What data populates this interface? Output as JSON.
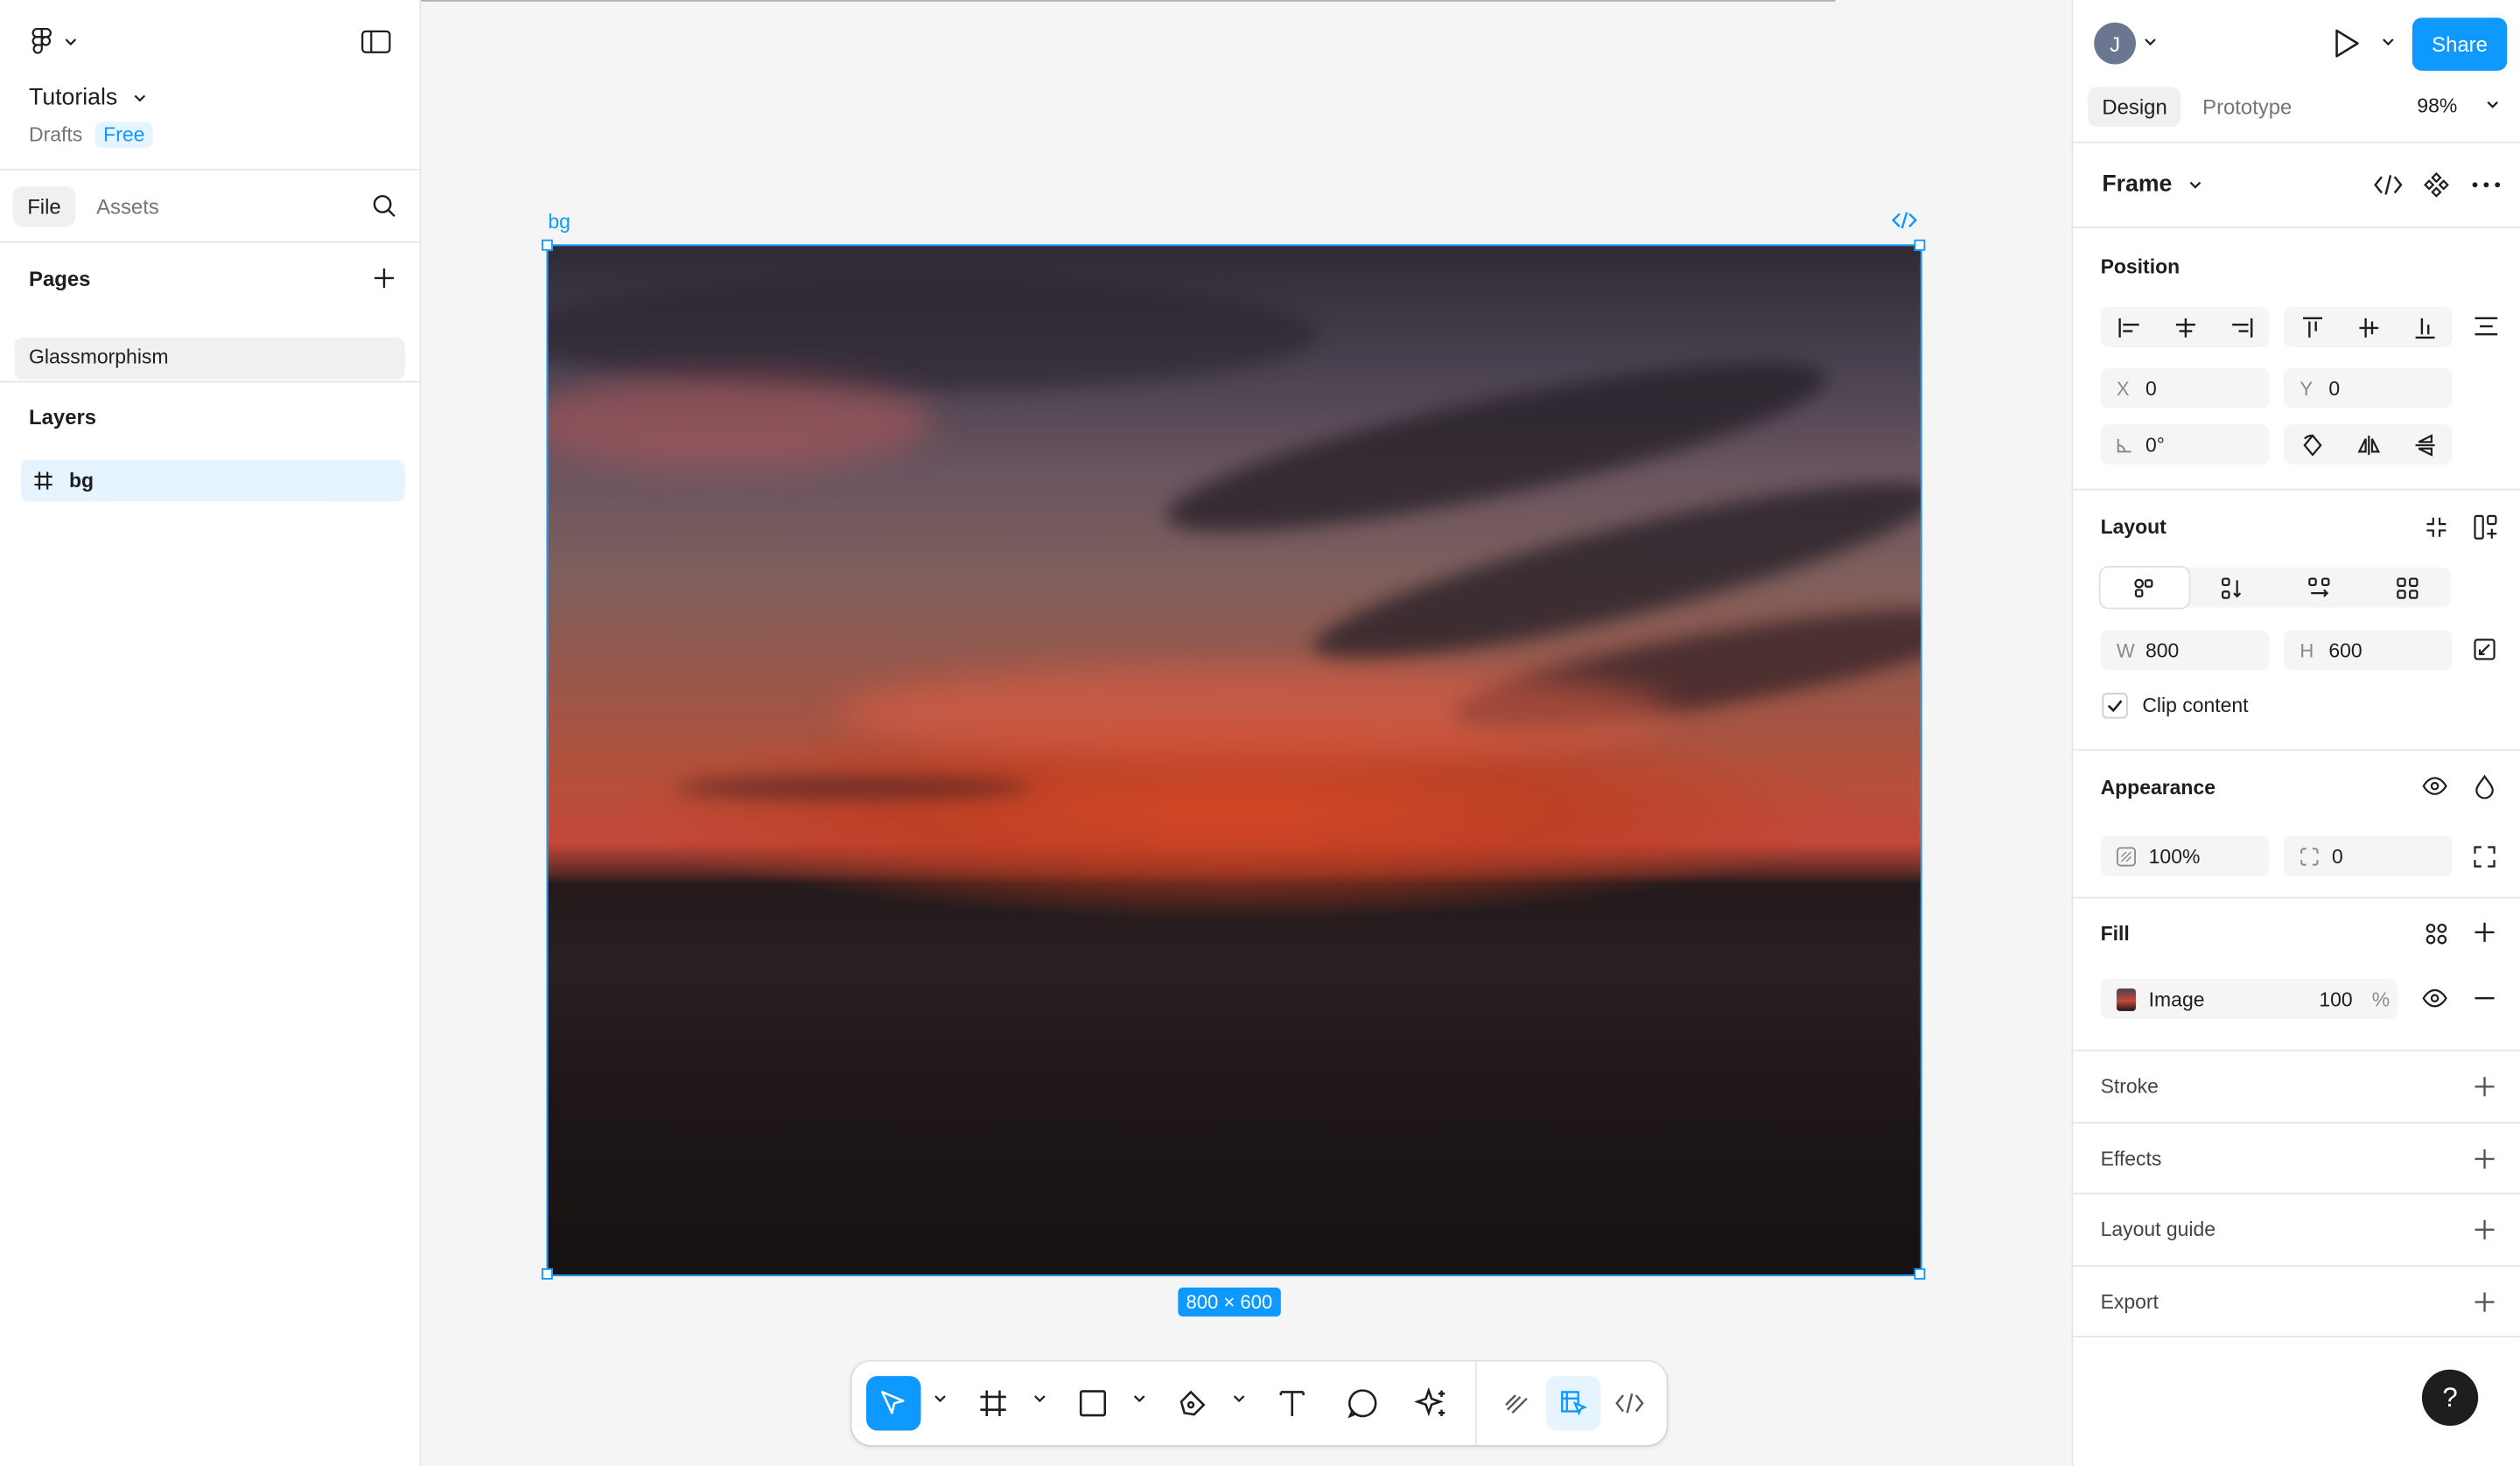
{
  "file": {
    "title": "Tutorials",
    "location": "Drafts",
    "plan_badge": "Free"
  },
  "left_tabs": [
    "File",
    "Assets"
  ],
  "pages": {
    "heading": "Pages",
    "items": [
      "Glassmorphism"
    ]
  },
  "layers": {
    "heading": "Layers",
    "items": [
      {
        "name": "bg",
        "icon": "frame-icon"
      }
    ]
  },
  "canvas": {
    "frame_name": "bg",
    "size_badge": "800 × 600"
  },
  "toolbar": {
    "tools": [
      "move-tool",
      "frame-tool",
      "shape-tool",
      "pen-tool",
      "text-tool",
      "comment-tool",
      "actions-tool",
      "draw-mode",
      "design-mode",
      "dev-mode"
    ]
  },
  "right_panel": {
    "avatar_initial": "J",
    "share_label": "Share",
    "tabs": [
      "Design",
      "Prototype"
    ],
    "zoom": "98%",
    "selection_type": "Frame",
    "position": {
      "heading": "Position",
      "x_label": "X",
      "x": "0",
      "y_label": "Y",
      "y": "0",
      "rotation": "0°"
    },
    "layout": {
      "heading": "Layout",
      "w_label": "W",
      "w": "800",
      "h_label": "H",
      "h": "600",
      "clip_label": "Clip content",
      "clip_checked": true
    },
    "appearance": {
      "heading": "Appearance",
      "opacity": "100%",
      "radius": "0"
    },
    "fill": {
      "heading": "Fill",
      "type": "Image",
      "opacity": "100",
      "unit": "%"
    },
    "collapsed_sections": [
      "Stroke",
      "Effects",
      "Layout guide",
      "Export"
    ],
    "help": "?"
  },
  "colors": {
    "accent": "#0d99ff",
    "panel_bg": "#ffffff",
    "canvas_bg": "#f5f5f5"
  }
}
